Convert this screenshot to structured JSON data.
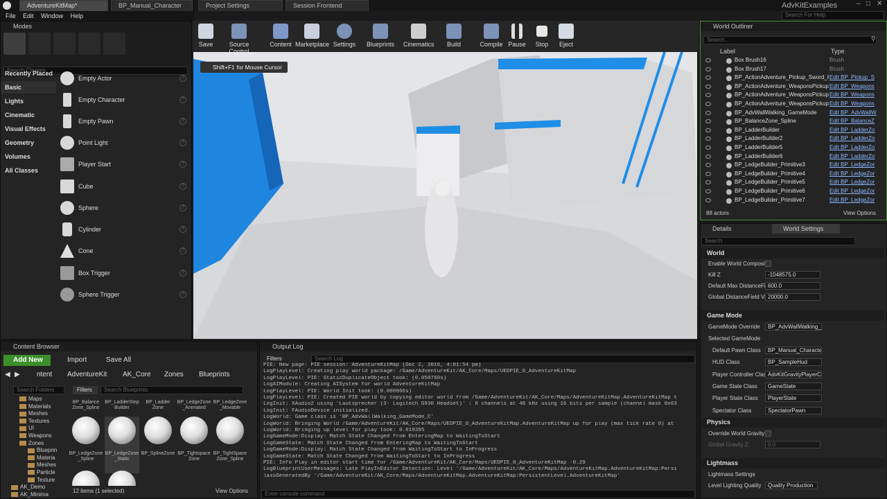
{
  "tabs": [
    "AdventureKitMap*",
    "BP_Manual_Character",
    "Project Settings",
    "Session Frontend"
  ],
  "project_name": "AdvKitExamples",
  "help_search": "Search For Help",
  "menu": [
    "File",
    "Edit",
    "Window",
    "Help"
  ],
  "modes": {
    "title": "Modes",
    "search_placeholder": "Search Classes",
    "categories": [
      "Recently Placed",
      "Basic",
      "Lights",
      "Cinematic",
      "Visual Effects",
      "Geometry",
      "Volumes",
      "All Classes"
    ],
    "actors": [
      "Empty Actor",
      "Empty Character",
      "Empty Pawn",
      "Point Light",
      "Player Start",
      "Cube",
      "Sphere",
      "Cylinder",
      "Cone",
      "Box Trigger",
      "Sphere Trigger"
    ]
  },
  "toolbar": [
    "Save",
    "Source Control",
    "Content",
    "Marketplace",
    "Settings",
    "Blueprints",
    "Cinematics",
    "Build",
    "Compile",
    "Pause",
    "Stop",
    "Eject"
  ],
  "viewport": {
    "hint": "Shift+F1 for Mouse Cursor"
  },
  "outliner": {
    "title": "World Outliner",
    "search_placeholder": "Search...",
    "col_label": "Label",
    "col_type": "Type",
    "rows": [
      {
        "label": "Box Brush16",
        "type": "Brush"
      },
      {
        "label": "Box Brush17",
        "type": "Brush"
      },
      {
        "label": "BP_ActionAdventure_Pickup_Sword_R",
        "type": "Edit BP_Pickup_S"
      },
      {
        "label": "BP_ActionAdventure_WeaponsPickup",
        "type": "Edit BP_Weapons"
      },
      {
        "label": "BP_ActionAdventure_WeaponsPickup",
        "type": "Edit BP_Weapons"
      },
      {
        "label": "BP_ActionAdventure_WeaponsPickup",
        "type": "Edit BP_Weapons"
      },
      {
        "label": "BP_AdvWallWalking_GameMode",
        "type": "Edit BP_AdvWallW"
      },
      {
        "label": "BP_BalanceZone_Spline",
        "type": "Edit BP_BalanceZ"
      },
      {
        "label": "BP_LadderBuilder",
        "type": "Edit BP_LadderZo"
      },
      {
        "label": "BP_LadderBuilder2",
        "type": "Edit BP_LadderZo"
      },
      {
        "label": "BP_LadderBuilder5",
        "type": "Edit BP_LadderZo"
      },
      {
        "label": "BP_LadderBuilder6",
        "type": "Edit BP_LadderZo"
      },
      {
        "label": "BP_LedgeBuilder_Primitive3",
        "type": "Edit BP_LedgeZor"
      },
      {
        "label": "BP_LedgeBuilder_Primitive4",
        "type": "Edit BP_LedgeZor"
      },
      {
        "label": "BP_LedgeBuilder_Primitive5",
        "type": "Edit BP_LedgeZor"
      },
      {
        "label": "BP_LedgeBuilder_Primitive6",
        "type": "Edit BP_LedgeZor"
      },
      {
        "label": "BP_LedgeBuilder_Primitive7",
        "type": "Edit BP_LedgeZor"
      }
    ],
    "count": "88 actors",
    "view_options": "View Options"
  },
  "details": {
    "tab1": "Details",
    "tab2": "World Settings",
    "search_placeholder": "Search",
    "world": "World",
    "enable_composition": "Enable World Composit",
    "killz_label": "Kill Z",
    "killz": "-1048575.0",
    "maxdist_label": "Default Max DistanceFi",
    "maxdist": "600.0",
    "gdist_label": "Global DistanceField Vi",
    "gdist": "20000.0",
    "gamemode": "Game Mode",
    "gm_override_label": "GameMode Override",
    "gm_override": "BP_AdvWallWalking_(",
    "selected_gm": "Selected GameMode",
    "fields": [
      {
        "label": "Default Pawn Class",
        "value": "BP_Manual_Characte"
      },
      {
        "label": "HUD Class",
        "value": "BP_SampleHud"
      },
      {
        "label": "Player Controller Clas",
        "value": "AdvKitGravityPlayerC"
      },
      {
        "label": "Game State Class",
        "value": "GameState"
      },
      {
        "label": "Player State Class",
        "value": "PlayerState"
      },
      {
        "label": "Spectator Class",
        "value": "SpectatorPawn"
      }
    ],
    "physics": "Physics",
    "override_gravity": "Override World Gravity",
    "global_gravity_label": "Global Gravity Z",
    "global_gravity": "0.0",
    "lightmass": "Lightmass",
    "lightmass_settings": "Lightmass Settings",
    "lighting_quality_label": "Level Lighting Quality",
    "lighting_quality": "Quality Production"
  },
  "content_browser": {
    "title": "Content Browser",
    "add_new": "Add New",
    "import": "Import",
    "save_all": "Save All",
    "path": [
      "ntent",
      "AdventureKit",
      "AK_Core",
      "Zones",
      "Blueprints"
    ],
    "filters": "Filters",
    "search_placeholder": "Search Blueprints",
    "search_folders": "Search Folders",
    "folders": [
      "Maps",
      "Materials",
      "Meshes",
      "Textures",
      "UI",
      "Weapons",
      "Zones",
      "Blueprin",
      "Materia",
      "Meshes",
      "Particle",
      "Texture",
      "AK_Demo",
      "AK_Minima"
    ],
    "top_labels": [
      "BP_Balance Zone_Spline",
      "BP_LadderStep Builder",
      "BP_Ladder Zone",
      "BP_LedgeZone _Animated",
      "BP_LedgeZone _Movable"
    ],
    "tiles": [
      "BP_LedgeZone _Spline",
      "BP_LedgeZone _Static",
      "BP_SplineZone",
      "BP_Tightspace Zone",
      "BP_TightSpace Zone_Spline"
    ],
    "status": "12 items (1 selected)",
    "view_options": "View Options"
  },
  "output_log": {
    "title": "Output Log",
    "filters": "Filters",
    "search_placeholder": "Search Log",
    "console_placeholder": "Enter console command",
    "lines": [
      "PIE: New page: PIE session: AdventureKitMap (Dec 2, 2016, 4:01:54 pm)",
      "LogPlayLevel: Creating play world package: /Game/AdventureKit/AK_Core/Maps/UEDPIE_0_AdventureKitMap",
      "LogPlayLevel: PIE: StaticDuplicateObject took: (0.050760s)",
      "LogAIModule: Creating AISystem for world AdventureKitMap",
      "LogPlayLevel: PIE: World Init took: (0.000966s)",
      "LogPlayLevel: PIE: Created PIE world by copying editor world from /Game/AdventureKit/AK_Core/Maps/AdventureKitMap.AdventureKitMap t",
      "LogInit: XAudio2 using 'Lautsprecher (3- Logitech G930 Headset)' : 8 channels at 48 kHz using 16 bits per sample (channel mask 0x63",
      "LogInit: FAudioDevice initialized.",
      "LogWorld: Game class is 'BP_AdvWallWalking_GameMode_C'",
      "LogWorld: Bringing World /Game/AdventureKit/AK_Core/Maps/UEDPIE_0_AdventureKitMap.AdventureKitMap up for play (max tick rate 0) at",
      "LogWorld: Bringing up level for play took: 0.019395",
      "LogGameMode:Display: Match State Changed from EnteringMap to WaitingToStart",
      "LogGameState: Match State Changed from EnteringMap to WaitingToStart",
      "LogGameMode:Display: Match State Changed from WaitingToStart to InProgress",
      "LogGameState: Match State Changed from WaitingToStart to InProgress",
      "PIE: Info Play in editor start time for /Game/AdventureKit/AK_Core/Maps/UEDPIE_0_AdventureKitMap -0.29",
      "LogBlueprintUserMessages: Late PlayInEditor Detection: Level '/Game/AdventureKit/AK_Core/Maps/AdventureKitMap.AdventureKitMap:Persi",
      "lassGeneratedBy '/Game/AdventureKit/AK_Core/Maps/AdventureKitMap.AdventureKitMap:PersistentLevel.AdventureKitMap'"
    ]
  }
}
